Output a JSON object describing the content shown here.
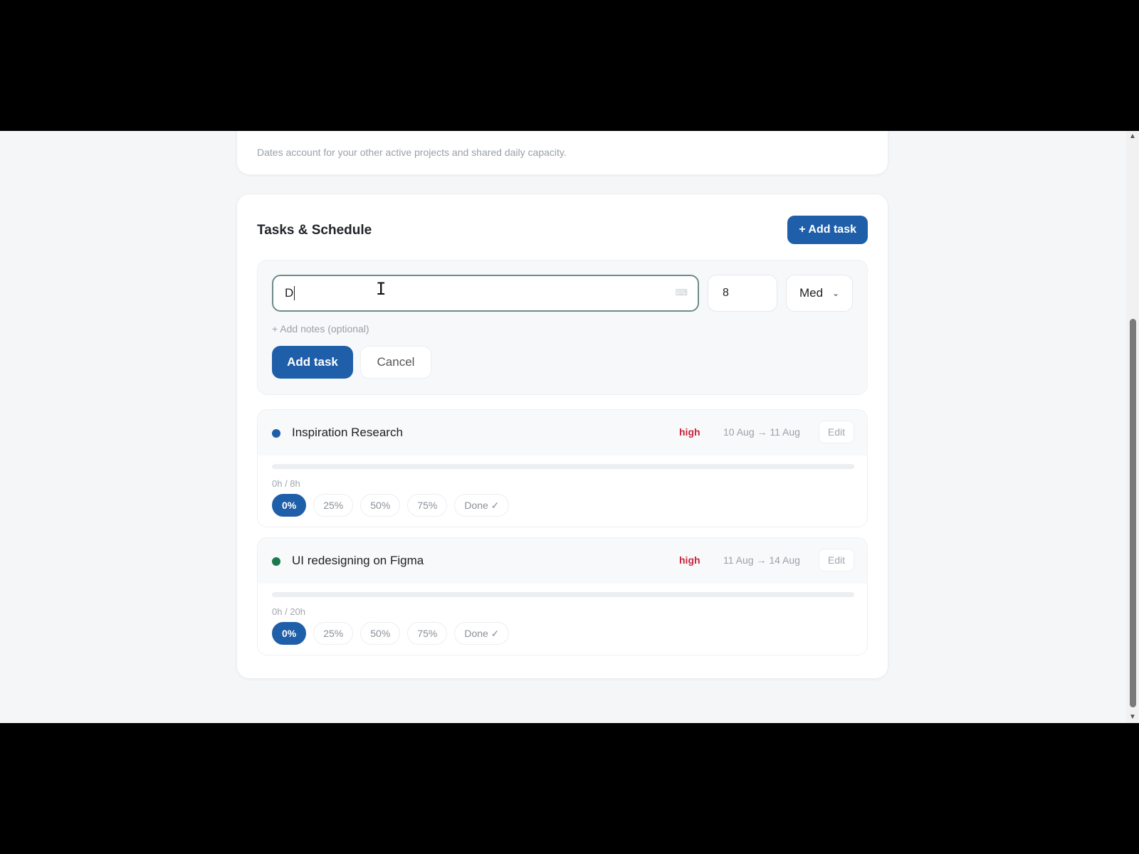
{
  "header_card": {
    "note": "Dates account for your other active projects and shared daily capacity."
  },
  "tasks_section": {
    "title": "Tasks & Schedule",
    "add_task_label": "+ Add task"
  },
  "new_task_form": {
    "title_value": "D",
    "hours_value": "8",
    "priority_value": "Med",
    "add_notes_label": "+ Add notes (optional)",
    "submit_label": "Add task",
    "cancel_label": "Cancel"
  },
  "tasks": [
    {
      "name": "Inspiration Research",
      "priority": "high",
      "dates": "10 Aug → 11 Aug",
      "edit_label": "Edit",
      "hours": "0h / 8h",
      "progress": 0,
      "dot_color": "#1f5ea8",
      "options": [
        "0%",
        "25%",
        "50%",
        "75%",
        "Done ✓"
      ]
    },
    {
      "name": "UI redesigning on Figma",
      "priority": "high",
      "dates": "11 Aug → 14 Aug",
      "edit_label": "Edit",
      "hours": "0h / 20h",
      "progress": 0,
      "dot_color": "#1a7a4c",
      "options": [
        "0%",
        "25%",
        "50%",
        "75%",
        "Done ✓"
      ]
    }
  ],
  "colors": {
    "accent": "#1f5ea8",
    "priority_high": "#c8263a"
  }
}
